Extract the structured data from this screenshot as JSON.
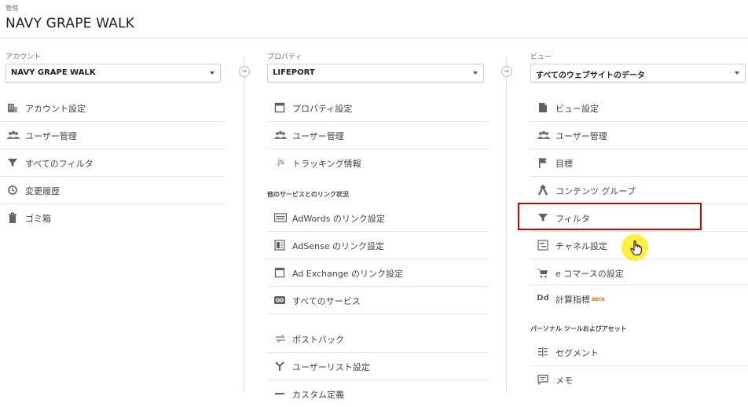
{
  "header": {
    "admin_label": "管理",
    "account_title": "NAVY GRAPE WALK"
  },
  "account": {
    "label": "アカウント",
    "selected": "NAVY GRAPE WALK",
    "items": [
      {
        "label": "アカウント設定",
        "icon": "building-icon"
      },
      {
        "label": "ユーザー管理",
        "icon": "people-icon"
      },
      {
        "label": "すべてのフィルタ",
        "icon": "filter-icon"
      },
      {
        "label": "変更履歴",
        "icon": "history-icon"
      },
      {
        "label": "ゴミ箱",
        "icon": "trash-icon"
      }
    ]
  },
  "property": {
    "label": "プロパティ",
    "selected": "LIFEPORT",
    "items": [
      {
        "label": "プロパティ設定",
        "icon": "property-icon"
      },
      {
        "label": "ユーザー管理",
        "icon": "people-icon"
      },
      {
        "label": "トラッキング情報",
        "icon": "js-icon"
      }
    ],
    "link_section": "他のサービスとのリンク状況",
    "link_items": [
      {
        "label": "AdWords のリンク設定",
        "icon": "adwords-icon"
      },
      {
        "label": "AdSense のリンク設定",
        "icon": "adsense-icon"
      },
      {
        "label": "Ad Exchange のリンク設定",
        "icon": "adexchange-icon"
      },
      {
        "label": "すべてのサービス",
        "icon": "link-icon"
      }
    ],
    "more_items": [
      {
        "label": "ポストバック",
        "icon": "postback-icon"
      },
      {
        "label": "ユーザーリスト設定",
        "icon": "userlist-icon"
      },
      {
        "label": "カスタム定義",
        "icon": "custom-icon"
      }
    ]
  },
  "view": {
    "label": "ビュー",
    "selected": "すべてのウェブサイトのデータ",
    "items": [
      {
        "label": "ビュー設定",
        "icon": "document-icon"
      },
      {
        "label": "ユーザー管理",
        "icon": "people-icon"
      },
      {
        "label": "目標",
        "icon": "flag-icon"
      },
      {
        "label": "コンテンツ グループ",
        "icon": "content-group-icon"
      },
      {
        "label": "フィルタ",
        "icon": "filter-icon"
      },
      {
        "label": "チャネル設定",
        "icon": "channel-icon"
      },
      {
        "label": "e コマースの設定",
        "icon": "cart-icon"
      },
      {
        "label": "計算指標",
        "icon": "dd-icon",
        "badge": "BETA"
      }
    ],
    "tools_section": "パーソナル ツールおよびアセット",
    "tools_items": [
      {
        "label": "セグメント",
        "icon": "segment-icon"
      },
      {
        "label": "メモ",
        "icon": "memo-icon"
      }
    ]
  },
  "colors": {
    "highlight": "#d50000",
    "cursor_glow": "#ffeb00",
    "beta": "#e8710a"
  }
}
